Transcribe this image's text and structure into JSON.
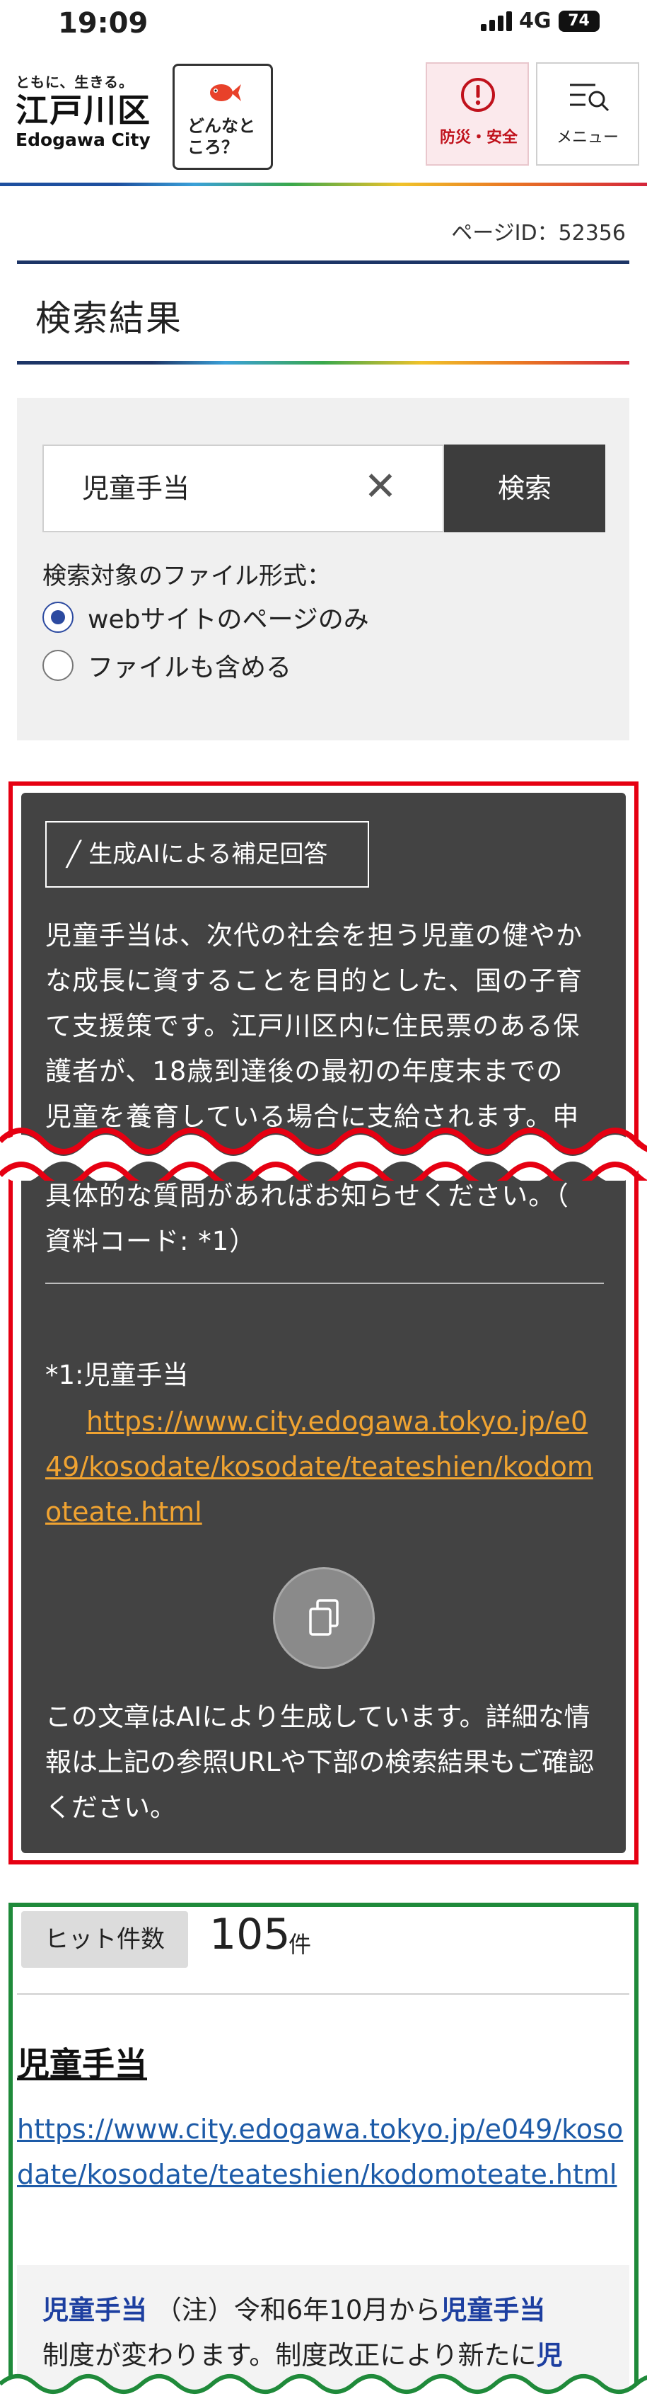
{
  "status_bar": {
    "time": "19:09",
    "network": "4G",
    "battery": "74"
  },
  "header": {
    "logo_tagline": "ともに、生きる。",
    "logo_main": "江戸川区",
    "logo_sub": "Edogawa City",
    "donna_text": "どんなところ？",
    "bousai_label": "防災・安全",
    "menu_label": "メニュー"
  },
  "page": {
    "id_text": "ページID：52356",
    "title": "検索結果"
  },
  "search": {
    "value": "児童手当",
    "button": "検索",
    "filetype_label": "検索対象のファイル形式：",
    "options": [
      {
        "label": "webサイトのページのみ",
        "selected": true
      },
      {
        "label": "ファイルも含める",
        "selected": false
      }
    ]
  },
  "ai": {
    "badge": "╱ 生成AIによる補足回答",
    "para1_lines": [
      "児童手当は、次代の社会を担う児童の健やか",
      "な成長に資することを目的とした、国の子育",
      "て支援策です。江戸川区内に住民票のある保",
      "護者が、18歳到達後の最初の年度末までの",
      "児童を養育している場合に支給されます。申"
    ],
    "para2_lines": [
      "具体的な質問があればお知らせください。（",
      "資料コード: *1）"
    ],
    "ref_label": "*1:児童手当",
    "ref_url": "https://www.city.edogawa.tokyo.jp/e049/kosodate/kosodate/teateshien/kodomoteate.html",
    "note": "この文章はAIにより生成しています。詳細な情報は上記の参照URLや下部の検索結果もご確認ください。"
  },
  "results": {
    "hit_label": "ヒット件数",
    "hit_count": "105",
    "hit_unit": "件",
    "item": {
      "title": "児童手当",
      "url": "https://www.city.edogawa.tokyo.jp/e049/kosodate/kosodate/teateshien/kodomoteate.html",
      "snippet_kw1": "児童手当",
      "snippet_mid1": "（注）令和6年10月から",
      "snippet_kw2": "児童手当",
      "snippet_line2": "制度が変わります。制度改正により新たに",
      "snippet_kw3": "児"
    }
  },
  "colors": {
    "accent_red": "#e60012",
    "accent_green": "#1f8a3a",
    "ai_bg": "#434343",
    "link_orange": "#f0a331",
    "link_blue": "#1d5ba8"
  }
}
